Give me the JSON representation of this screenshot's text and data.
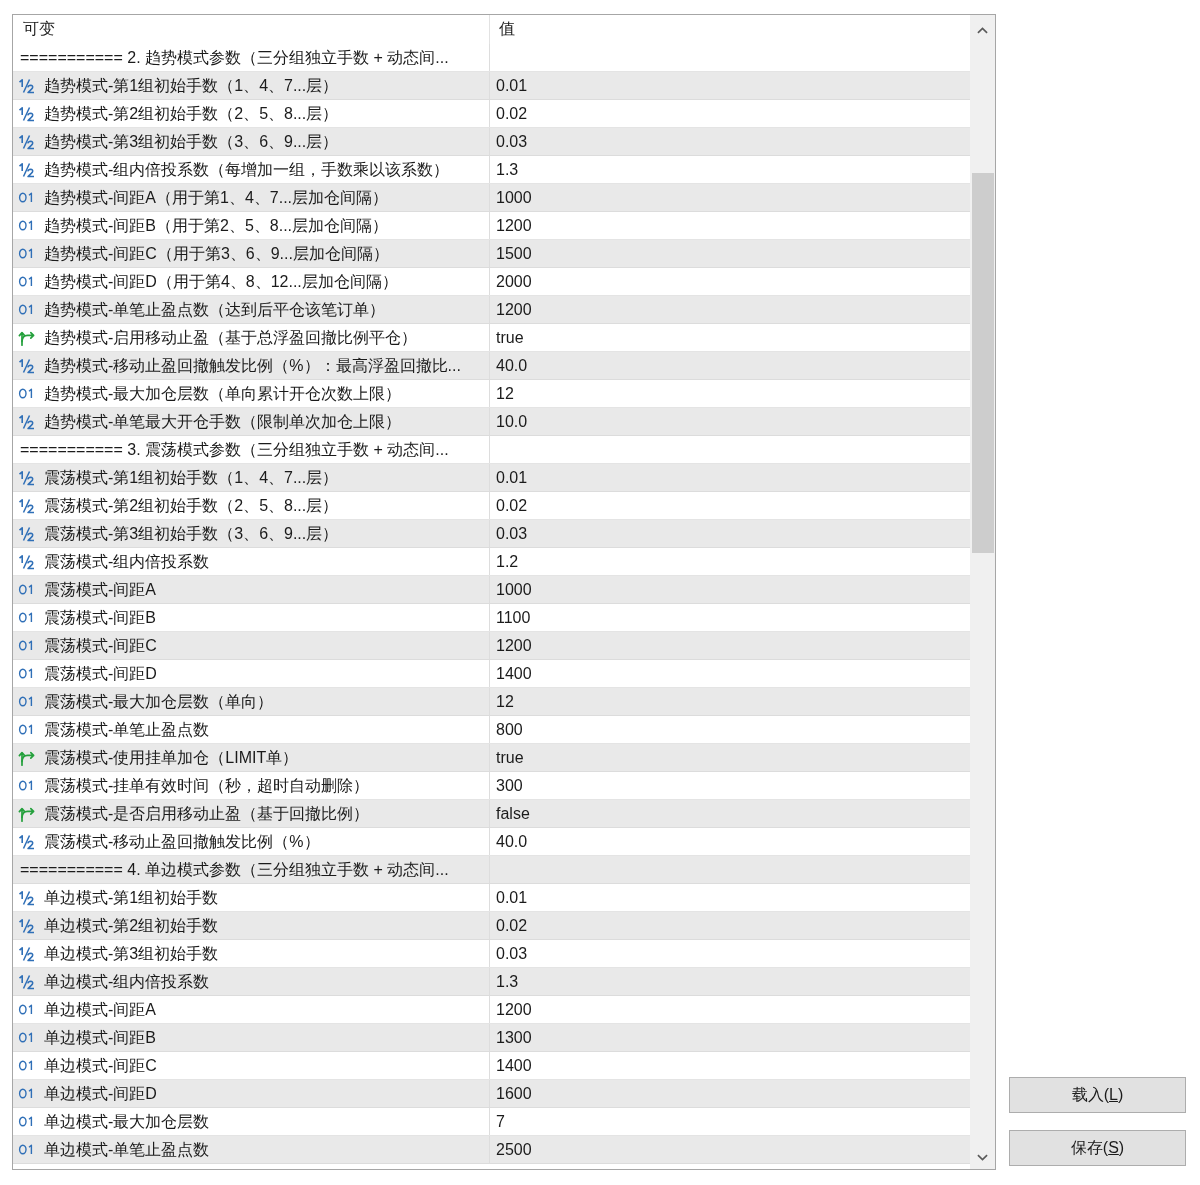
{
  "columns": [
    {
      "label": "可变"
    },
    {
      "label": "值"
    }
  ],
  "rows": [
    {
      "kind": "section",
      "name": "=========== 2. 趋势模式参数（三分组独立手数 + 动态间..."
    },
    {
      "kind": "double",
      "name": "趋势模式-第1组初始手数（1、4、7...层）",
      "value": "0.01"
    },
    {
      "kind": "double",
      "name": "趋势模式-第2组初始手数（2、5、8...层）",
      "value": "0.02"
    },
    {
      "kind": "double",
      "name": "趋势模式-第3组初始手数（3、6、9...层）",
      "value": "0.03"
    },
    {
      "kind": "double",
      "name": "趋势模式-组内倍投系数（每增加一组，手数乘以该系数）",
      "value": "1.3"
    },
    {
      "kind": "integer",
      "name": "趋势模式-间距A（用于第1、4、7...层加仓间隔）",
      "value": "1000"
    },
    {
      "kind": "integer",
      "name": "趋势模式-间距B（用于第2、5、8...层加仓间隔）",
      "value": "1200"
    },
    {
      "kind": "integer",
      "name": "趋势模式-间距C（用于第3、6、9...层加仓间隔）",
      "value": "1500"
    },
    {
      "kind": "integer",
      "name": "趋势模式-间距D（用于第4、8、12...层加仓间隔）",
      "value": "2000"
    },
    {
      "kind": "integer",
      "name": "趋势模式-单笔止盈点数（达到后平仓该笔订单）",
      "value": "1200"
    },
    {
      "kind": "bool",
      "name": "趋势模式-启用移动止盈（基于总浮盈回撤比例平仓）",
      "value": "true"
    },
    {
      "kind": "double",
      "name": "趋势模式-移动止盈回撤触发比例（%）：最高浮盈回撤比...",
      "value": "40.0"
    },
    {
      "kind": "integer",
      "name": "趋势模式-最大加仓层数（单向累计开仓次数上限）",
      "value": "12"
    },
    {
      "kind": "double",
      "name": "趋势模式-单笔最大开仓手数（限制单次加仓上限）",
      "value": "10.0"
    },
    {
      "kind": "section",
      "name": "=========== 3. 震荡模式参数（三分组独立手数 + 动态间..."
    },
    {
      "kind": "double",
      "name": "震荡模式-第1组初始手数（1、4、7...层）",
      "value": "0.01"
    },
    {
      "kind": "double",
      "name": "震荡模式-第2组初始手数（2、5、8...层）",
      "value": "0.02"
    },
    {
      "kind": "double",
      "name": "震荡模式-第3组初始手数（3、6、9...层）",
      "value": "0.03"
    },
    {
      "kind": "double",
      "name": "震荡模式-组内倍投系数",
      "value": "1.2"
    },
    {
      "kind": "integer",
      "name": "震荡模式-间距A",
      "value": "1000"
    },
    {
      "kind": "integer",
      "name": "震荡模式-间距B",
      "value": "1100"
    },
    {
      "kind": "integer",
      "name": "震荡模式-间距C",
      "value": "1200"
    },
    {
      "kind": "integer",
      "name": "震荡模式-间距D",
      "value": "1400"
    },
    {
      "kind": "integer",
      "name": "震荡模式-最大加仓层数（单向）",
      "value": "12"
    },
    {
      "kind": "integer",
      "name": "震荡模式-单笔止盈点数",
      "value": "800"
    },
    {
      "kind": "bool",
      "name": "震荡模式-使用挂单加仓（LIMIT单）",
      "value": "true"
    },
    {
      "kind": "integer",
      "name": "震荡模式-挂单有效时间（秒，超时自动删除）",
      "value": "300"
    },
    {
      "kind": "bool",
      "name": "震荡模式-是否启用移动止盈（基于回撤比例）",
      "value": "false"
    },
    {
      "kind": "double",
      "name": "震荡模式-移动止盈回撤触发比例（%）",
      "value": "40.0"
    },
    {
      "kind": "section",
      "name": "=========== 4. 单边模式参数（三分组独立手数 + 动态间..."
    },
    {
      "kind": "double",
      "name": "单边模式-第1组初始手数",
      "value": "0.01"
    },
    {
      "kind": "double",
      "name": "单边模式-第2组初始手数",
      "value": "0.02"
    },
    {
      "kind": "double",
      "name": "单边模式-第3组初始手数",
      "value": "0.03"
    },
    {
      "kind": "double",
      "name": "单边模式-组内倍投系数",
      "value": "1.3"
    },
    {
      "kind": "integer",
      "name": "单边模式-间距A",
      "value": "1200"
    },
    {
      "kind": "integer",
      "name": "单边模式-间距B",
      "value": "1300"
    },
    {
      "kind": "integer",
      "name": "单边模式-间距C",
      "value": "1400"
    },
    {
      "kind": "integer",
      "name": "单边模式-间距D",
      "value": "1600"
    },
    {
      "kind": "integer",
      "name": "单边模式-最大加仓层数",
      "value": "7"
    },
    {
      "kind": "integer",
      "name": "单边模式-单笔止盈点数",
      "value": "2500"
    }
  ],
  "buttons": [
    {
      "label_start": "载入(",
      "access_key": "L",
      "label_end": ")"
    },
    {
      "label_start": "保存(",
      "access_key": "S",
      "label_end": ")"
    }
  ]
}
